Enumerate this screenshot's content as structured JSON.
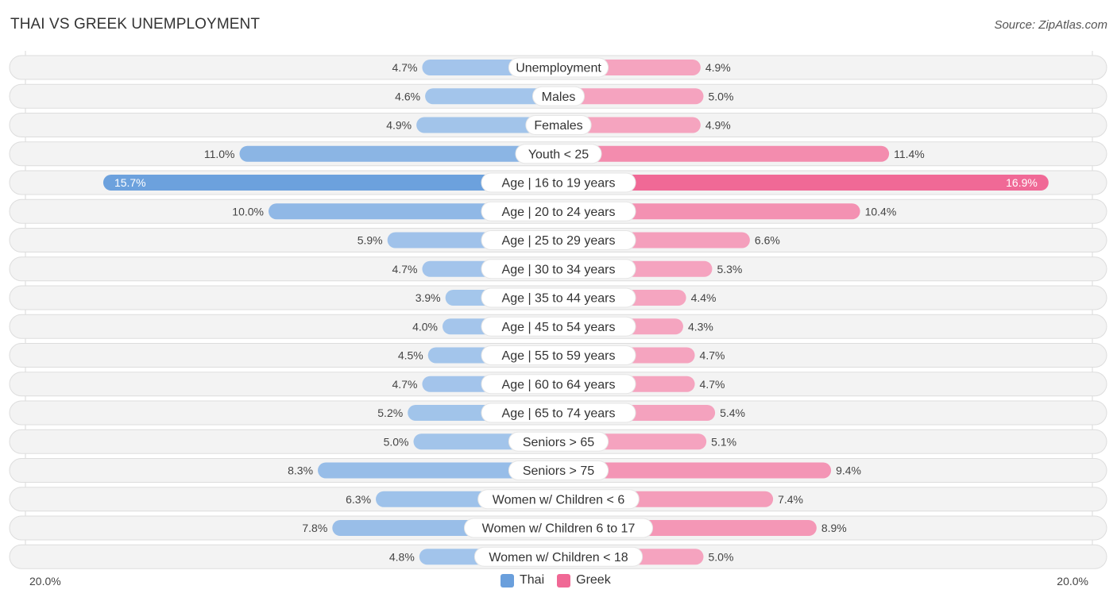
{
  "header": {
    "title": "THAI VS GREEK UNEMPLOYMENT",
    "source": "Source: ZipAtlas.com"
  },
  "colors": {
    "thai_strong": "#6a9fdc",
    "thai_light": "#a8c8ec",
    "greek_strong": "#f06895",
    "greek_light": "#f5a9c3",
    "row_bg": "#f3f3f3",
    "row_border": "#dddddd"
  },
  "legend": {
    "items": [
      {
        "label": "Thai",
        "color": "#6a9fdc"
      },
      {
        "label": "Greek",
        "color": "#f06895"
      }
    ]
  },
  "axis": {
    "left_label": "20.0%",
    "right_label": "20.0%"
  },
  "chart_data": {
    "type": "bar",
    "orientation": "horizontal-diverging",
    "title": "THAI VS GREEK UNEMPLOYMENT",
    "xlabel": "",
    "ylabel": "",
    "xlim": [
      -20,
      20
    ],
    "legend_position": "bottom-center",
    "categories": [
      "Unemployment",
      "Males",
      "Females",
      "Youth < 25",
      "Age | 16 to 19 years",
      "Age | 20 to 24 years",
      "Age | 25 to 29 years",
      "Age | 30 to 34 years",
      "Age | 35 to 44 years",
      "Age | 45 to 54 years",
      "Age | 55 to 59 years",
      "Age | 60 to 64 years",
      "Age | 65 to 74 years",
      "Seniors > 65",
      "Seniors > 75",
      "Women w/ Children < 6",
      "Women w/ Children 6 to 17",
      "Women w/ Children < 18"
    ],
    "series": [
      {
        "name": "Thai",
        "side": "left",
        "values": [
          4.7,
          4.6,
          4.9,
          11.0,
          15.7,
          10.0,
          5.9,
          4.7,
          3.9,
          4.0,
          4.5,
          4.7,
          5.2,
          5.0,
          8.3,
          6.3,
          7.8,
          4.8
        ],
        "labels": [
          "4.7%",
          "4.6%",
          "4.9%",
          "11.0%",
          "15.7%",
          "10.0%",
          "5.9%",
          "4.7%",
          "3.9%",
          "4.0%",
          "4.5%",
          "4.7%",
          "5.2%",
          "5.0%",
          "8.3%",
          "6.3%",
          "7.8%",
          "4.8%"
        ]
      },
      {
        "name": "Greek",
        "side": "right",
        "values": [
          4.9,
          5.0,
          4.9,
          11.4,
          16.9,
          10.4,
          6.6,
          5.3,
          4.4,
          4.3,
          4.7,
          4.7,
          5.4,
          5.1,
          9.4,
          7.4,
          8.9,
          5.0
        ],
        "labels": [
          "4.9%",
          "5.0%",
          "4.9%",
          "11.4%",
          "16.9%",
          "10.4%",
          "6.6%",
          "5.3%",
          "4.4%",
          "4.3%",
          "4.7%",
          "4.7%",
          "5.4%",
          "5.1%",
          "9.4%",
          "7.4%",
          "8.9%",
          "5.0%"
        ]
      }
    ],
    "axis_tick_labels": [
      "20.0%",
      "20.0%"
    ]
  }
}
